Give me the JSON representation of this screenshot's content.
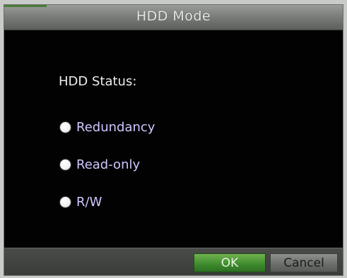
{
  "dialog": {
    "title": "HDD Mode",
    "status_label": "HDD Status:",
    "options": [
      {
        "label": "Redundancy",
        "selected": false
      },
      {
        "label": "Read-only",
        "selected": false
      },
      {
        "label": "R/W",
        "selected": false
      }
    ],
    "ok_label": "OK",
    "cancel_label": "Cancel"
  },
  "colors": {
    "background": "#020202",
    "titlebar": "#7c7e7c",
    "ok_button": "#3d8a2d",
    "cancel_button": "#6b6d6b",
    "option_text": "#cfc8ff"
  }
}
